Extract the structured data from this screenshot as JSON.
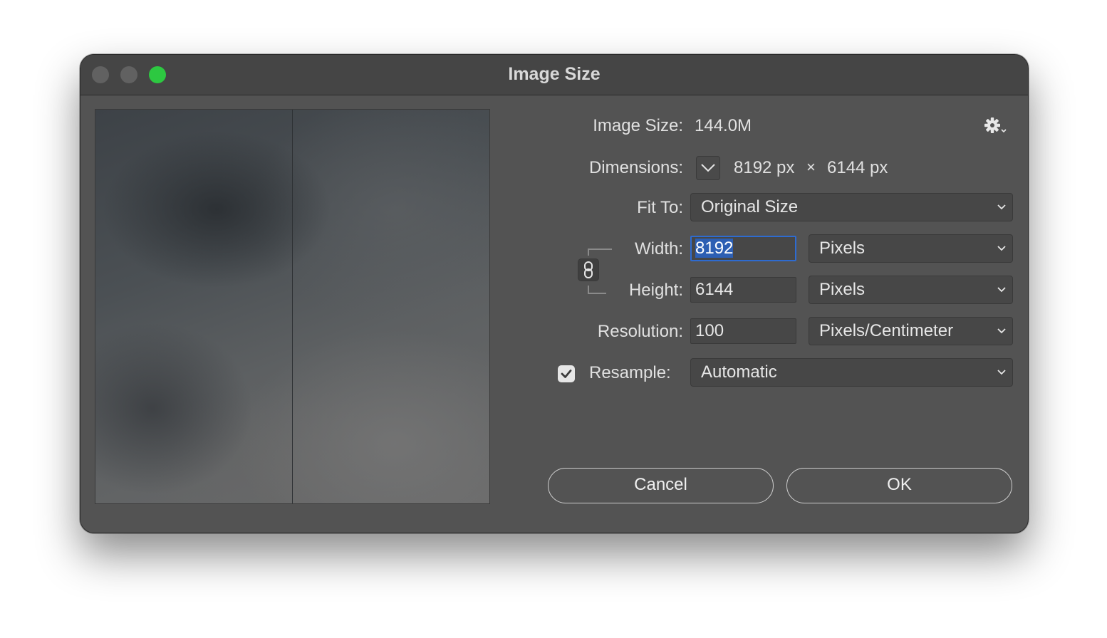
{
  "window": {
    "title": "Image Size"
  },
  "info": {
    "image_size_label": "Image Size:",
    "image_size_value": "144.0M",
    "dimensions_label": "Dimensions:",
    "dimensions_width": "8192 px",
    "dimensions_separator": "×",
    "dimensions_height": "6144 px"
  },
  "fit_to": {
    "label": "Fit To:",
    "value": "Original Size"
  },
  "width": {
    "label": "Width:",
    "value": "8192",
    "unit": "Pixels"
  },
  "height": {
    "label": "Height:",
    "value": "6144",
    "unit": "Pixels"
  },
  "resolution": {
    "label": "Resolution:",
    "value": "100",
    "unit": "Pixels/Centimeter"
  },
  "resample": {
    "label": "Resample:",
    "checked": true,
    "value": "Automatic"
  },
  "buttons": {
    "cancel": "Cancel",
    "ok": "OK"
  },
  "colors": {
    "close": "#616161",
    "minimize": "#616161",
    "zoom": "#2dc841",
    "focus_ring": "#2e6bd0",
    "selection": "#2d5fb3"
  },
  "icons": {
    "settings": "gear-icon",
    "dimensions_toggle": "chevron-down-icon",
    "constrain": "link-icon",
    "dropdown": "chevron-down-icon",
    "checkmark": "checkmark-icon"
  }
}
